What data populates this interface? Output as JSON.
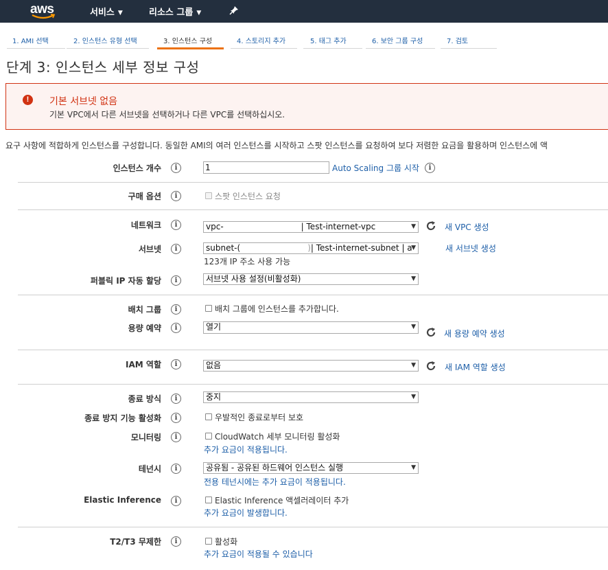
{
  "nav": {
    "logo": "aws",
    "services": "서비스",
    "resource_groups": "리소스 그룹"
  },
  "steps": [
    {
      "label": "1. AMI 선택",
      "active": false
    },
    {
      "label": "2. 인스턴스 유형 선택",
      "active": false
    },
    {
      "label": "3. 인스턴스 구성",
      "active": true
    },
    {
      "label": "4. 스토리지 추가",
      "active": false
    },
    {
      "label": "5. 태그 추가",
      "active": false
    },
    {
      "label": "6. 보안 그룹 구성",
      "active": false
    },
    {
      "label": "7. 검토",
      "active": false
    }
  ],
  "page_title": "단계 3: 인스턴스 세부 정보 구성",
  "alert": {
    "title": "기본 서브넷 없음",
    "body": "기본 VPC에서 다른 서브넷을 선택하거나 다른 VPC를 선택하십시오."
  },
  "description": "요구 사항에 적합하게 인스턴스를 구성합니다. 동일한 AMI의 여러 인스턴스를 시작하고 스팟 인스턴스를 요청하여 보다 저렴한 요금을 활용하며 인스턴스에 액",
  "fields": {
    "instance_count": {
      "label": "인스턴스 개수",
      "value": "1",
      "link": "Auto Scaling 그룹 시작"
    },
    "purchase_option": {
      "label": "구매 옵션",
      "checkbox": "스팟 인스턴스 요청"
    },
    "network": {
      "label": "네트워크",
      "value_prefix": "vpc-",
      "value_suffix": "| Test-internet-vpc",
      "link": "새 VPC 생성"
    },
    "subnet": {
      "label": "서브넷",
      "value_prefix": "subnet-(",
      "value_suffix": "| Test-internet-subnet | a",
      "link": "새 서브넷 생성",
      "note": "123개 IP 주소 사용 가능"
    },
    "public_ip": {
      "label": "퍼블릭 IP 자동 할당",
      "value": "서브넷 사용 설정(비활성화)"
    },
    "placement_group": {
      "label": "배치 그룹",
      "checkbox": "배치 그룹에 인스턴스를 추가합니다."
    },
    "capacity_reservation": {
      "label": "용량 예약",
      "value": "열기",
      "link": "새 용량 예약 생성"
    },
    "iam_role": {
      "label": "IAM 역할",
      "value": "없음",
      "link": "새 IAM 역할 생성"
    },
    "shutdown_behavior": {
      "label": "종료 방식",
      "value": "중지"
    },
    "termination_protection": {
      "label": "종료 방지 기능 활성화",
      "checkbox": "우발적인 종료로부터 보호"
    },
    "monitoring": {
      "label": "모니터링",
      "checkbox": "CloudWatch 세부 모니터링 활성화",
      "note": "추가 요금이 적용됩니다."
    },
    "tenancy": {
      "label": "테넌시",
      "value": "공유됨 - 공유된 하드웨어 인스턴스 실행",
      "note": "전용 테넌시에는 추가 요금이 적용됩니다."
    },
    "elastic_inference": {
      "label": "Elastic Inference",
      "checkbox": "Elastic Inference 액셀러레이터 추가",
      "note": "추가 요금이 발생합니다."
    },
    "t2t3_unlimited": {
      "label": "T2/T3 무제한",
      "checkbox": "활성화",
      "note": "추가 요금이 적용될 수 있습니다"
    }
  },
  "info_glyph": "i",
  "select_arrow": "▼",
  "colors": {
    "nav_bg": "#232f3e",
    "accent": "#ec7211",
    "link": "#1e5fa8",
    "error": "#d13212"
  }
}
